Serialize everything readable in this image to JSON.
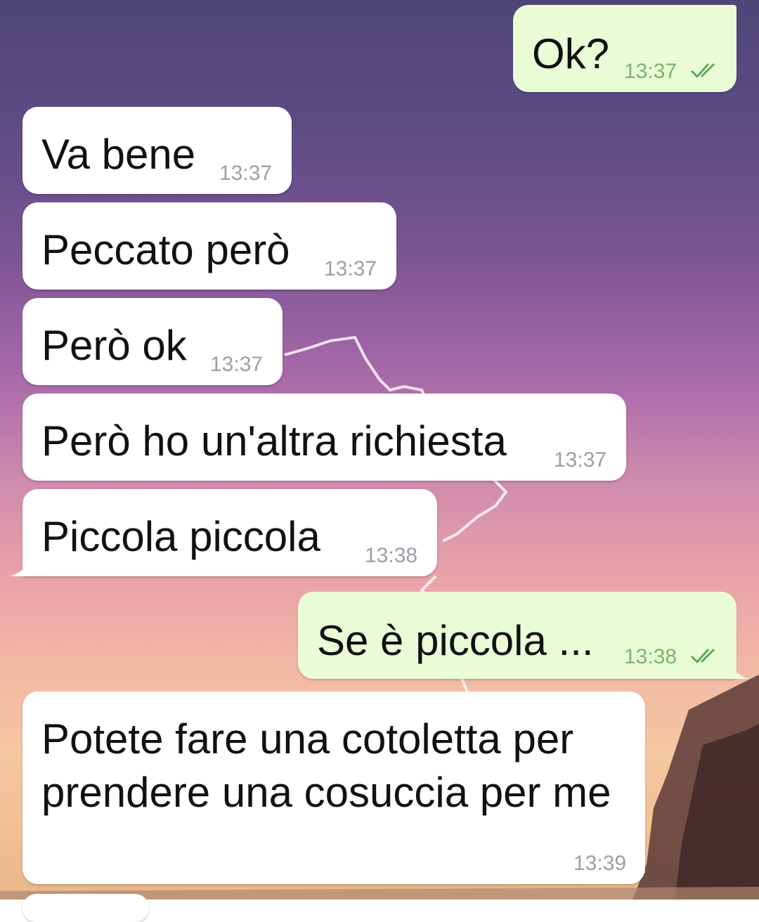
{
  "messages": [
    {
      "direction": "out",
      "text": "Ok?",
      "time": "13:37",
      "status_icon": "double-check-icon",
      "status": "read"
    },
    {
      "direction": "in",
      "text": "Va bene",
      "time": "13:37"
    },
    {
      "direction": "in",
      "text": "Peccato però",
      "time": "13:37"
    },
    {
      "direction": "in",
      "text": "Però ok",
      "time": "13:37"
    },
    {
      "direction": "in",
      "text": "Però ho un'altra richiesta",
      "time": "13:37"
    },
    {
      "direction": "in",
      "text": "Piccola piccola",
      "time": "13:38"
    },
    {
      "direction": "out",
      "text": "Se è piccola ...",
      "time": "13:38",
      "status_icon": "double-check-icon",
      "status": "read"
    },
    {
      "direction": "in",
      "text": "Potete fare una cotoletta per prendere una cosuccia per me",
      "time": "13:39"
    }
  ],
  "colors": {
    "incoming_bubble": "#ffffff",
    "outgoing_bubble": "#eafcd6",
    "time_incoming": "#9aa0a6",
    "time_outgoing": "#7cb46c",
    "read_ticks": "#5fa85a"
  }
}
